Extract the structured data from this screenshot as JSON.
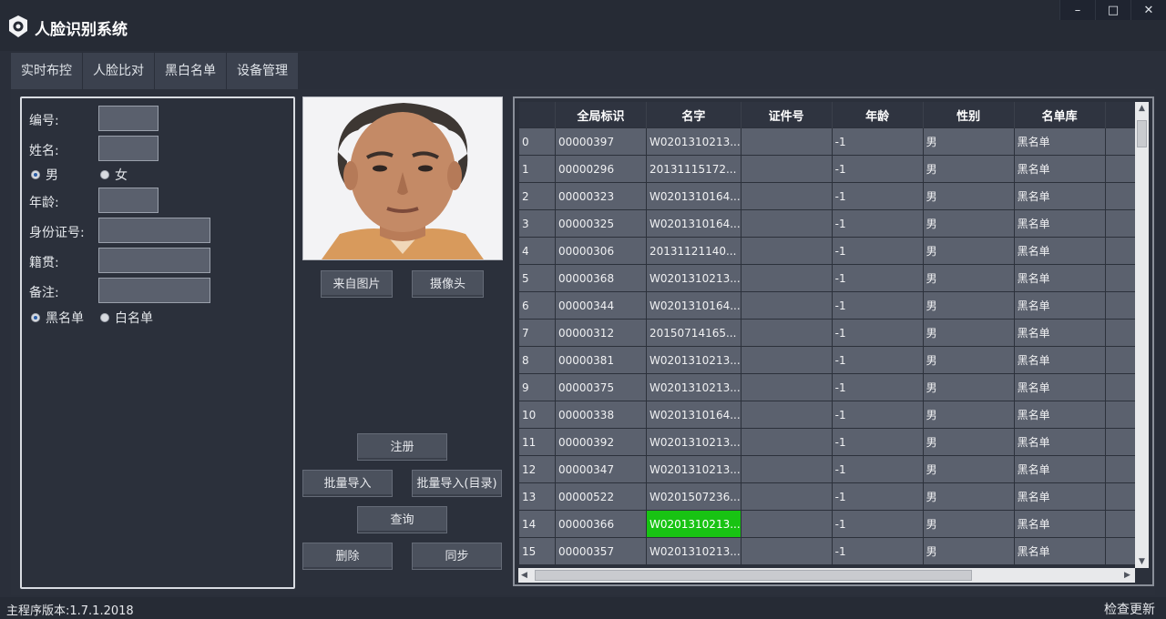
{
  "app": {
    "title": "人脸识别系统"
  },
  "window_controls": {
    "minimize": "–",
    "maximize": "□",
    "close": "✕"
  },
  "tabs": [
    "实时布控",
    "人脸比对",
    "黑白名单",
    "设备管理"
  ],
  "form": {
    "id_label": "编号:",
    "name_label": "姓名:",
    "gender_male": "男",
    "gender_female": "女",
    "gender_selected": "男",
    "age_label": "年龄:",
    "idcard_label": "身份证号:",
    "hometown_label": "籍贯:",
    "remark_label": "备注:",
    "list_black": "黑名单",
    "list_white": "白名单",
    "list_selected": "黑名单"
  },
  "buttons": {
    "from_image": "来自图片",
    "camera": "摄像头",
    "register": "注册",
    "batch_import": "批量导入",
    "batch_import_dir": "批量导入(目录)",
    "query": "查询",
    "delete": "删除",
    "sync": "同步"
  },
  "table": {
    "columns": [
      "",
      "全局标识",
      "名字",
      "证件号",
      "年龄",
      "性别",
      "名单库",
      ""
    ],
    "highlight_row": 14,
    "rows": [
      [
        "0",
        "00000397",
        "W0201310213...",
        "",
        "-1",
        "男",
        "黑名单"
      ],
      [
        "1",
        "00000296",
        "20131115172...",
        "",
        "-1",
        "男",
        "黑名单"
      ],
      [
        "2",
        "00000323",
        "W0201310164...",
        "",
        "-1",
        "男",
        "黑名单"
      ],
      [
        "3",
        "00000325",
        "W0201310164...",
        "",
        "-1",
        "男",
        "黑名单"
      ],
      [
        "4",
        "00000306",
        "20131121140...",
        "",
        "-1",
        "男",
        "黑名单"
      ],
      [
        "5",
        "00000368",
        "W0201310213...",
        "",
        "-1",
        "男",
        "黑名单"
      ],
      [
        "6",
        "00000344",
        "W0201310164...",
        "",
        "-1",
        "男",
        "黑名单"
      ],
      [
        "7",
        "00000312",
        "20150714165...",
        "",
        "-1",
        "男",
        "黑名单"
      ],
      [
        "8",
        "00000381",
        "W0201310213...",
        "",
        "-1",
        "男",
        "黑名单"
      ],
      [
        "9",
        "00000375",
        "W0201310213...",
        "",
        "-1",
        "男",
        "黑名单"
      ],
      [
        "10",
        "00000338",
        "W0201310164...",
        "",
        "-1",
        "男",
        "黑名单"
      ],
      [
        "11",
        "00000392",
        "W0201310213...",
        "",
        "-1",
        "男",
        "黑名单"
      ],
      [
        "12",
        "00000347",
        "W0201310213...",
        "",
        "-1",
        "男",
        "黑名单"
      ],
      [
        "13",
        "00000522",
        "W0201507236...",
        "",
        "-1",
        "男",
        "黑名单"
      ],
      [
        "14",
        "00000366",
        "W0201310213...",
        "",
        "-1",
        "男",
        "黑名单"
      ],
      [
        "15",
        "00000357",
        "W0201310213...",
        "",
        "-1",
        "男",
        "黑名单"
      ]
    ]
  },
  "status": {
    "version": "主程序版本:1.7.1.2018",
    "check_update": "检查更新"
  },
  "colors": {
    "highlight": "#18c313",
    "cell": "#5b616e",
    "background": "#2a2f3a"
  }
}
